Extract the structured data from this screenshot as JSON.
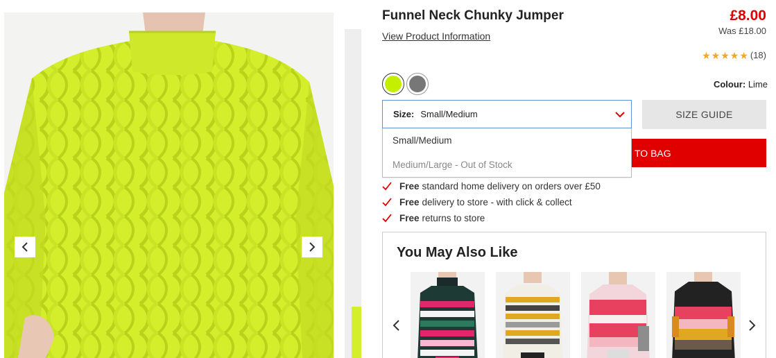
{
  "product": {
    "title": "Funnel Neck Chunky Jumper",
    "view_info_link": "View Product Information",
    "price": "£8.00",
    "was_price": "Was £18.00",
    "rating_stars": 5,
    "rating_count": "(18)",
    "colour_label": "Colour:",
    "colour_value": "Lime",
    "swatches": [
      {
        "name": "Lime",
        "color": "#c4f000",
        "selected": true
      },
      {
        "name": "Grey",
        "color": "#777777",
        "selected": false
      }
    ]
  },
  "size": {
    "label": "Size:",
    "selected": "Small/Medium",
    "options": [
      "Small/Medium",
      "Medium/Large - Out of Stock"
    ]
  },
  "buttons": {
    "size_guide": "SIZE GUIDE",
    "add_to_bag_visible": "TO BAG"
  },
  "delivery": [
    {
      "bold": "Free",
      "text": "standard home delivery on orders over £50"
    },
    {
      "bold": "Free",
      "text": "delivery to store - with click & collect"
    },
    {
      "bold": "Free",
      "text": "returns to store"
    }
  ],
  "recommendations": {
    "title": "You May Also Like",
    "items": [
      {
        "icon": "heart-stripe-jumper-image"
      },
      {
        "icon": "mustard-stripe-jumper-image"
      },
      {
        "icon": "pink-block-jumper-image"
      },
      {
        "icon": "colour-block-jumper-image"
      }
    ]
  },
  "colors": {
    "accent_red": "#e10000",
    "star": "#f5a623",
    "tick_red": "#e00000",
    "focus_border": "#5b8fd6"
  }
}
